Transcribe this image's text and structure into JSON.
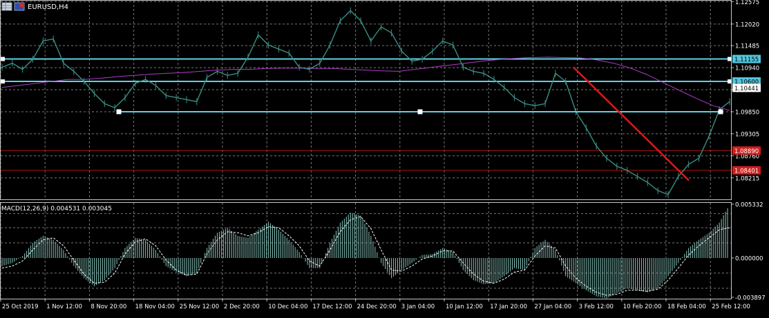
{
  "window": {
    "symbol_title": "EURUSD,H4"
  },
  "colors": {
    "background": "#000000",
    "grid": "#7a7a7a",
    "price_line": "#3a8f86",
    "moving_average": "#b03cc8",
    "level_line": "#5fd3e6",
    "level_line_red": "#b31010",
    "trend_line": "#e01818",
    "macd_hist": "#7fb8b0",
    "macd_signal": "#ffffff",
    "axis_text": "#ffffff",
    "label_cyan_bg": "#53c5dc",
    "label_red_bg": "#d21e1e"
  },
  "chart_data": [
    {
      "type": "line",
      "panel": "price",
      "title": "EURUSD,H4",
      "ylim": [
        1.077,
        1.1258
      ],
      "y_ticks": [
        "1.12575",
        "1.12020",
        "1.11485",
        "1.10940",
        "1.10395",
        "1.09850",
        "1.09305",
        "1.08760",
        "1.08215"
      ],
      "x_ticks": [
        "25 Oct 2019",
        "1 Nov 12:00",
        "8 Nov 20:00",
        "18 Nov 04:00",
        "25 Nov 12:00",
        "2 Dec 20:00",
        "10 Dec 04:00",
        "17 Dec 12:00",
        "24 Dec 20:00",
        "3 Jan 04:00",
        "10 Jan 12:00",
        "17 Jan 20:00",
        "27 Jan 04:00",
        "3 Feb 12:00",
        "10 Feb 20:00",
        "18 Feb 04:00",
        "25 Feb 12:00"
      ],
      "grid": true,
      "series": [
        {
          "role": "price",
          "values": [
            1.1095,
            1.1105,
            1.109,
            1.1115,
            1.116,
            1.1165,
            1.1105,
            1.1085,
            1.106,
            1.103,
            1.1005,
            1.0995,
            1.102,
            1.1055,
            1.1065,
            1.105,
            1.1025,
            1.102,
            1.1015,
            1.101,
            1.107,
            1.1085,
            1.1075,
            1.108,
            1.112,
            1.1175,
            1.115,
            1.114,
            1.113,
            1.1095,
            1.109,
            1.1105,
            1.115,
            1.121,
            1.1235,
            1.121,
            1.116,
            1.1195,
            1.118,
            1.1135,
            1.111,
            1.1115,
            1.1135,
            1.116,
            1.115,
            1.1095,
            1.1085,
            1.108,
            1.1065,
            1.1045,
            1.102,
            1.1005,
            1.1,
            1.1005,
            1.108,
            1.106,
            1.0985,
            1.0945,
            1.09,
            1.087,
            1.085,
            1.084,
            1.0825,
            1.081,
            1.079,
            1.078,
            1.0825,
            1.0855,
            1.087,
            1.0925,
            1.099,
            1.101
          ]
        },
        {
          "role": "moving_average",
          "values": [
            1.1045,
            1.105,
            1.1055,
            1.106,
            1.1065,
            1.1065,
            1.1068,
            1.1072,
            1.1075,
            1.1078,
            1.108,
            1.1082,
            1.1085,
            1.1088,
            1.109,
            1.109,
            1.1092,
            1.1093,
            1.1093,
            1.1092,
            1.1092,
            1.109,
            1.1088,
            1.1086,
            1.1085,
            1.109,
            1.1095,
            1.11,
            1.1105,
            1.111,
            1.1114,
            1.1117,
            1.1119,
            1.112,
            1.1119,
            1.1118,
            1.1113,
            1.1105,
            1.1093,
            1.1077,
            1.1057,
            1.1037,
            1.1018,
            1.1,
            1.0988
          ]
        }
      ],
      "levels": [
        {
          "value": 1.11155,
          "label": "1.11155",
          "style": "cyan_flag"
        },
        {
          "value": 1.106,
          "label": "1.10600",
          "style": "cyan_flag"
        },
        {
          "value": 1.10441,
          "label": "1.10441",
          "style": "plain_flag"
        },
        {
          "value": 1.0889,
          "label": "1.08890",
          "style": "red_flag"
        },
        {
          "value": 1.08401,
          "label": "1.08401",
          "style": "red_flag"
        }
      ],
      "support_line": {
        "value": 1.0985
      },
      "trend_line": {
        "from": 1.1095,
        "to": 1.0815
      }
    },
    {
      "type": "bar",
      "panel": "indicator",
      "title": "MACD(12,26,9) 0.004531 0.003045",
      "ylim": [
        -0.003897,
        0.005332
      ],
      "y_ticks": [
        "0.005332",
        "0.000000",
        "-0.003897"
      ],
      "series": [
        {
          "role": "macd_histogram",
          "values": [
            -0.0008,
            -0.0005,
            0.0002,
            0.0015,
            0.0022,
            0.0018,
            0.0008,
            -0.0008,
            -0.002,
            -0.0028,
            -0.0022,
            -0.001,
            0.001,
            0.002,
            0.0018,
            0.0008,
            -0.0008,
            -0.0014,
            -0.0018,
            -0.0015,
            0.001,
            0.0025,
            0.003,
            0.0022,
            0.002,
            0.0028,
            0.0036,
            0.0028,
            0.0018,
            0.0006,
            -0.001,
            -0.001,
            0.0015,
            0.0035,
            0.0045,
            0.0042,
            0.0022,
            -0.0005,
            -0.002,
            -0.0012,
            -0.0005,
            0.0003,
            0.0004,
            0.001,
            0.0006,
            -0.0012,
            -0.0022,
            -0.0026,
            -0.0025,
            -0.0018,
            -0.001,
            -0.0012,
            0.001,
            0.0018,
            0.0008,
            -0.0018,
            -0.0025,
            -0.0032,
            -0.0038,
            -0.004,
            -0.0035,
            -0.003,
            -0.0032,
            -0.0034,
            -0.003,
            -0.0018,
            -0.0005,
            0.001,
            0.0018,
            0.0025,
            0.0035,
            0.0053
          ]
        },
        {
          "role": "macd_signal",
          "values": [
            -0.001,
            -0.0008,
            -0.0003,
            0.0008,
            0.0018,
            0.002,
            0.0012,
            -0.0002,
            -0.0016,
            -0.0025,
            -0.0024,
            -0.0015,
            0.0004,
            0.0016,
            0.0019,
            0.0012,
            -0.0002,
            -0.0012,
            -0.0017,
            -0.0016,
            0.0004,
            0.0018,
            0.0026,
            0.0025,
            0.0022,
            0.0025,
            0.0031,
            0.003,
            0.0022,
            0.0012,
            -0.0003,
            -0.0008,
            0.0008,
            0.0026,
            0.0038,
            0.0041,
            0.0029,
            0.0008,
            -0.0012,
            -0.0013,
            -0.0008,
            -0.0001,
            0.0002,
            0.0007,
            0.0007,
            -0.0005,
            -0.0016,
            -0.0023,
            -0.0025,
            -0.0021,
            -0.0014,
            -0.0012,
            0.0002,
            0.0012,
            0.001,
            -0.0008,
            -0.002,
            -0.0028,
            -0.0034,
            -0.0037,
            -0.0036,
            -0.0032,
            -0.0032,
            -0.0033,
            -0.0031,
            -0.0022,
            -0.001,
            0.0003,
            0.0012,
            0.002,
            0.0028,
            0.003
          ]
        }
      ]
    }
  ]
}
